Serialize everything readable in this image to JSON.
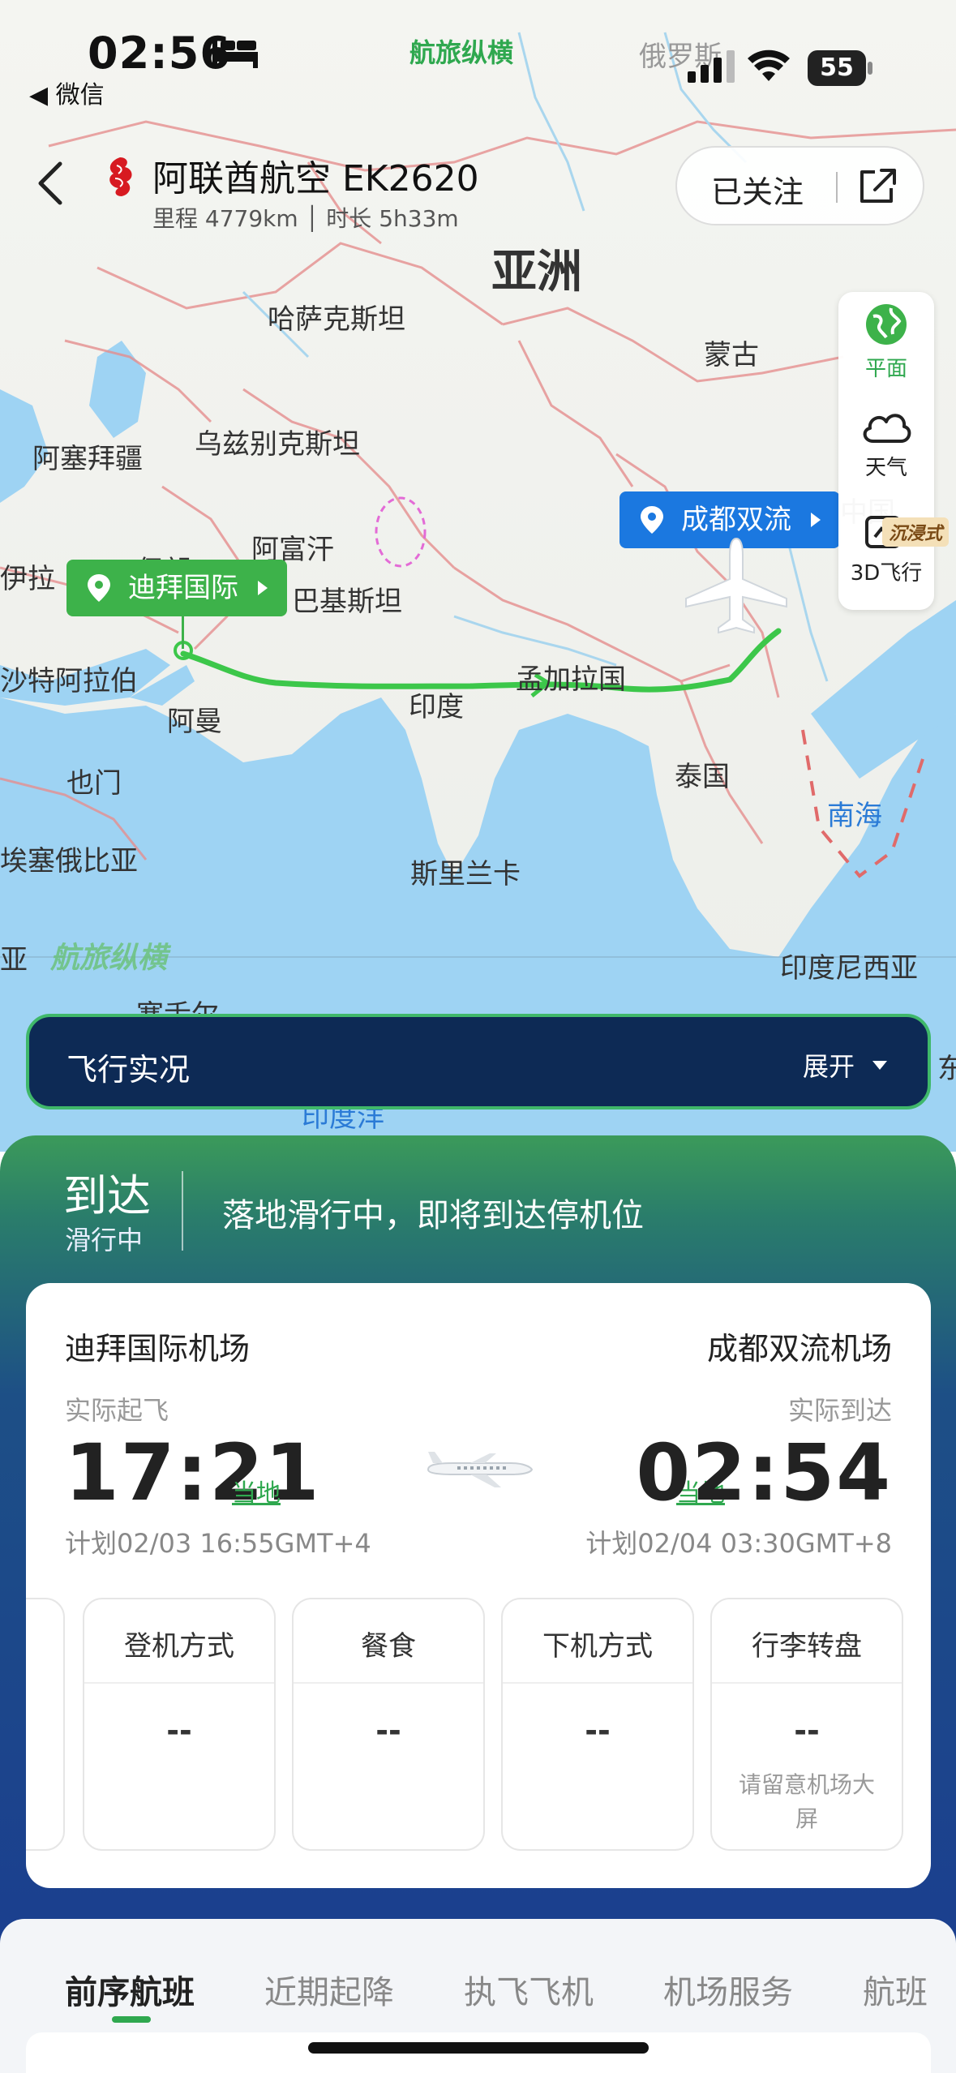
{
  "status_bar": {
    "time": "02:56",
    "back_app": "◀ 微信",
    "brand": "航旅纵横",
    "battery": "55"
  },
  "header": {
    "airline_flight": "阿联酋航空 EK2620",
    "meta": "里程 4779km │ 时长 5h33m",
    "follow_label": "已关注"
  },
  "map": {
    "labels": {
      "asia": "亚洲",
      "russia": "俄罗斯",
      "kazakhstan": "哈萨克斯坦",
      "mongolia": "蒙古",
      "azerbaijan": "阿塞拜疆",
      "uzbekistan": "乌兹别克斯坦",
      "afghanistan": "阿富汗",
      "iran": "伊朗",
      "iraq": "伊拉",
      "pakistan": "巴基斯坦",
      "saudi": "沙特阿拉伯",
      "oman": "阿曼",
      "india": "印度",
      "bangladesh": "孟加拉国",
      "china_frag": "中国",
      "thailand": "泰国",
      "south_sea": "南海",
      "yemen": "也门",
      "ethiopia": "埃塞俄比亚",
      "sri_lanka": "斯里兰卡",
      "indonesia": "印度尼西亚",
      "seychelles": "塞舌尔",
      "indian_ocean": "印度洋",
      "asia_frag": "亚",
      "east_frag": "东"
    },
    "origin_pin": "迪拜国际",
    "dest_pin": "成都双流",
    "watermark": "航旅纵横"
  },
  "tools": {
    "flat": "平面",
    "weather": "天气",
    "three_d": "3D飞行",
    "immersive_tag": "沉浸式"
  },
  "live_bar": {
    "title": "飞行实况",
    "expand": "展开"
  },
  "status": {
    "state": "到达",
    "sub_state": "滑行中",
    "message": "落地滑行中，即将到达停机位"
  },
  "flight_card": {
    "departure": {
      "airport": "迪拜国际机场",
      "label": "实际起飞",
      "time": "17:21",
      "local": "当地",
      "plan": "计划02/03 16:55GMT+4"
    },
    "arrival": {
      "airport": "成都双流机场",
      "label": "实际到达",
      "time": "02:54",
      "local": "当地",
      "plan": "计划02/04 03:30GMT+8"
    },
    "info": [
      {
        "title": "登机方式",
        "value": "--",
        "note": ""
      },
      {
        "title": "餐食",
        "value": "--",
        "note": ""
      },
      {
        "title": "下机方式",
        "value": "--",
        "note": ""
      },
      {
        "title": "行李转盘",
        "value": "--",
        "note": "请留意机场大屏"
      }
    ]
  },
  "tabs": [
    "前序航班",
    "近期起降",
    "执飞飞机",
    "机场服务",
    "航班"
  ],
  "colors": {
    "brand_green": "#2fa84f",
    "pin_blue": "#1b78e0",
    "live_bar_navy": "#0d2a55",
    "panel_blue": "#1b3f8f"
  }
}
